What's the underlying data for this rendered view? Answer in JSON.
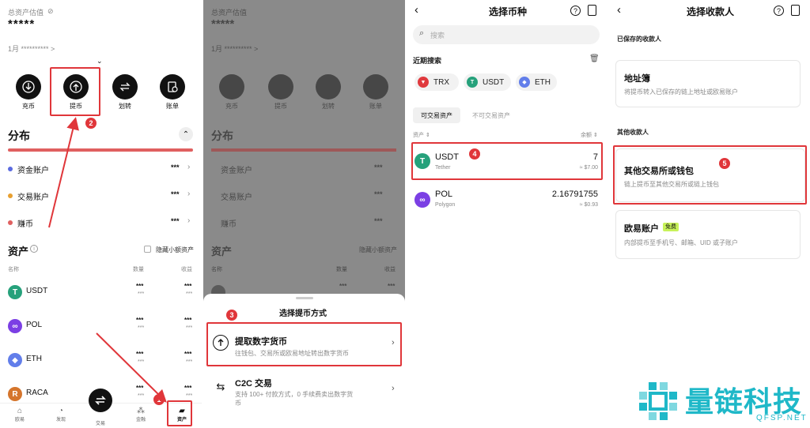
{
  "screen1": {
    "total_label": "总资产估值",
    "total_value": "*****",
    "subline": "1月 ********** >",
    "actions": [
      {
        "label": "充币",
        "icon": "deposit-icon"
      },
      {
        "label": "提币",
        "icon": "withdraw-icon"
      },
      {
        "label": "划转",
        "icon": "transfer-icon"
      },
      {
        "label": "账单",
        "icon": "bill-icon"
      }
    ],
    "distribution_title": "分布",
    "accounts": [
      {
        "label": "资金账户",
        "value": "***",
        "color": "#5b6be0"
      },
      {
        "label": "交易账户",
        "value": "***",
        "color": "#e8a030"
      },
      {
        "label": "赚币",
        "value": "***",
        "color": "#e06060"
      }
    ],
    "assets_title": "资产",
    "hide_small_label": "隐藏小额资产",
    "columns": {
      "name": "名称",
      "qty": "数量",
      "pnl": "收益"
    },
    "assets": [
      {
        "name": "USDT",
        "qty": "***",
        "qty2": "***",
        "pnl": "***",
        "pnl2": "***",
        "color": "#26a17b",
        "glyph": "T"
      },
      {
        "name": "POL",
        "qty": "***",
        "qty2": "***",
        "pnl": "***",
        "pnl2": "***",
        "color": "#7b3fe4",
        "glyph": "∞"
      },
      {
        "name": "ETH",
        "qty": "***",
        "qty2": "***",
        "pnl": "***",
        "pnl2": "***",
        "color": "#627eea",
        "glyph": "◆"
      },
      {
        "name": "RACA",
        "qty": "***",
        "qty2": "***",
        "pnl": "***",
        "pnl2": "***",
        "color": "#d5752c",
        "glyph": "R"
      }
    ],
    "nav": [
      {
        "label": "欧易",
        "icon": "home-icon"
      },
      {
        "label": "发现",
        "icon": "discover-icon"
      },
      {
        "label": "交易",
        "icon": "trade-icon"
      },
      {
        "label": "金融",
        "icon": "finance-icon"
      },
      {
        "label": "资产",
        "icon": "wallet-icon"
      }
    ],
    "badges": {
      "b1": "1",
      "b2": "2"
    }
  },
  "screen2": {
    "sheet_title": "选择提币方式",
    "options": [
      {
        "title": "提取数字货币",
        "desc": "往钱包、交易所或欧易地址转出数字货币"
      },
      {
        "title": "C2C 交易",
        "desc": "支持 100+ 付款方式，0 手续费卖出数字货",
        "desc2": "币"
      }
    ],
    "badge": "3"
  },
  "screen3": {
    "title": "选择币种",
    "search_placeholder": "搜索",
    "recent_title": "近期搜索",
    "recent": [
      {
        "name": "TRX",
        "color": "#e03a3e",
        "glyph": "▼"
      },
      {
        "name": "USDT",
        "color": "#26a17b",
        "glyph": "T"
      },
      {
        "name": "ETH",
        "color": "#627eea",
        "glyph": "◆"
      }
    ],
    "tabs": [
      "可交易资产",
      "不可交易资产"
    ],
    "col_asset": "资产 ⇕",
    "col_balance": "余额 ⇕",
    "coins": [
      {
        "symbol": "USDT",
        "name": "Tether",
        "amount": "7",
        "fiat": "≈ $7.00",
        "color": "#26a17b",
        "glyph": "T"
      },
      {
        "symbol": "POL",
        "name": "Polygon",
        "amount": "2.16791755",
        "fiat": "≈ $0.93",
        "color": "#7b3fe4",
        "glyph": "∞"
      }
    ],
    "badge": "4"
  },
  "screen4": {
    "title": "选择收款人",
    "saved_section": "已保存的收款人",
    "address_book_title": "地址簿",
    "address_book_desc": "将提币转入已保存的链上地址或欧易账户",
    "other_section": "其他收款人",
    "other_title": "其他交易所或钱包",
    "other_desc": "链上提币至其他交易所或链上钱包",
    "okx_title": "欧易账户",
    "okx_tag": "免费",
    "okx_desc": "内部提币至手机号、邮箱、UID 或子账户",
    "badge": "5",
    "brand_name": "量链科技",
    "brand_domain": "QFSP.NET",
    "brand_color": "#1fb8c8"
  },
  "colors": {
    "accent_red": "#e0363a",
    "progress_red": "#e06060"
  }
}
